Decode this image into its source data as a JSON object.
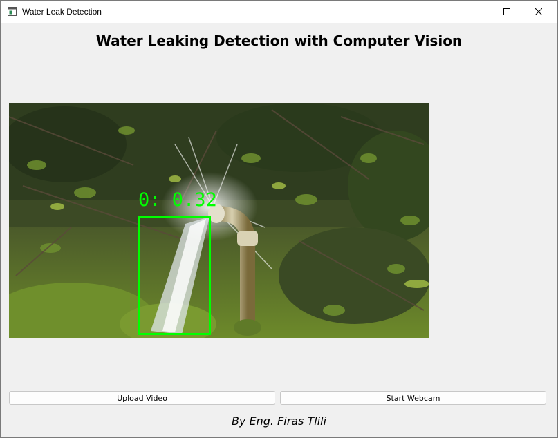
{
  "window": {
    "title": "Water Leak Detection",
    "controls": {
      "minimize_icon": "minimize-icon",
      "maximize_icon": "maximize-icon",
      "close_icon": "close-icon"
    }
  },
  "main": {
    "heading": "Water Leaking Detection with Computer Vision",
    "video": {
      "detection": {
        "label": "0: 0.32",
        "color": "#00ff00"
      }
    },
    "buttons": {
      "upload_label": "Upload Video",
      "webcam_label": "Start Webcam"
    },
    "footer": "By Eng. Firas Tlili"
  },
  "colors": {
    "background": "#f0f0f0",
    "titlebar": "#ffffff",
    "detection_box": "#00ff00"
  }
}
